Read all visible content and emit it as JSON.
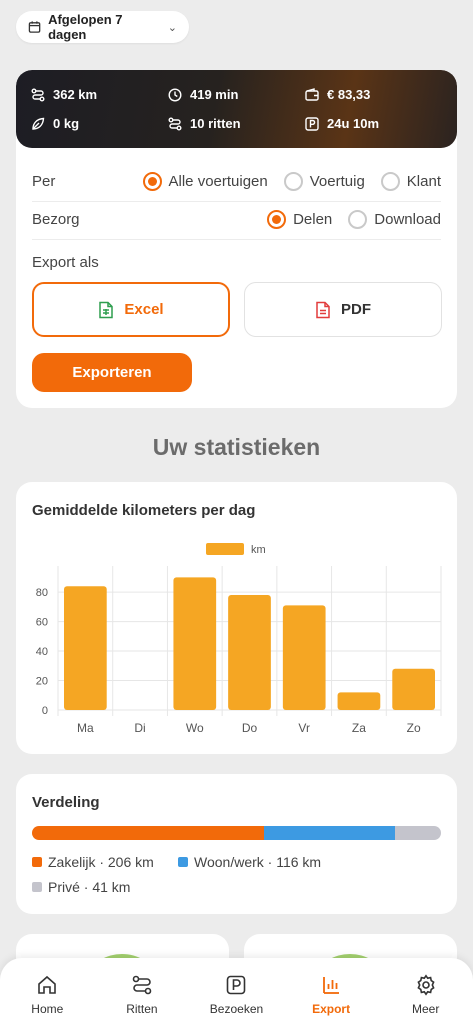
{
  "date_filter": {
    "label": "Afgelopen 7 dagen"
  },
  "stats": {
    "distance": "362 km",
    "duration": "419 min",
    "cost": "€ 83,33",
    "co2": "0 kg",
    "rides": "10 ritten",
    "parking": "24u 10m"
  },
  "export": {
    "per_label": "Per",
    "per_options": [
      "Alle voertuigen",
      "Voertuig",
      "Klant"
    ],
    "per_selected": "Alle voertuigen",
    "deliver_label": "Bezorg",
    "deliver_options": [
      "Delen",
      "Download"
    ],
    "deliver_selected": "Delen",
    "format_label": "Export als",
    "format_excel": "Excel",
    "format_pdf": "PDF",
    "format_selected": "Excel",
    "submit_label": "Exporteren"
  },
  "section_title": "Uw statistieken",
  "chart_card": {
    "title": "Gemiddelde kilometers per dag"
  },
  "chart_data": {
    "type": "bar",
    "title": "Gemiddelde kilometers per dag",
    "categories": [
      "Ma",
      "Di",
      "Wo",
      "Do",
      "Vr",
      "Za",
      "Zo"
    ],
    "series": [
      {
        "name": "km",
        "values": [
          84,
          0,
          90,
          78,
          71,
          12,
          28
        ],
        "color": "#f5a623"
      }
    ],
    "yticks": [
      0,
      20,
      40,
      60,
      80
    ],
    "ylim": [
      0,
      95
    ],
    "grid": true,
    "legend": "top-center",
    "xlabel": "",
    "ylabel": ""
  },
  "distribution": {
    "title": "Verdeling",
    "items": [
      {
        "label": "Zakelijk · 206 km",
        "value": 206,
        "color": "#f26a0a"
      },
      {
        "label": "Woon/werk · 116 km",
        "value": 116,
        "color": "#3d9ae2"
      },
      {
        "label": "Privé · 41 km",
        "value": 41,
        "color": "#c4c4cc"
      }
    ]
  },
  "nav": {
    "items": [
      "Home",
      "Ritten",
      "Bezoeken",
      "Export",
      "Meer"
    ],
    "active": "Export"
  },
  "colors": {
    "accent": "#f26a0a",
    "bar": "#f5a623"
  }
}
